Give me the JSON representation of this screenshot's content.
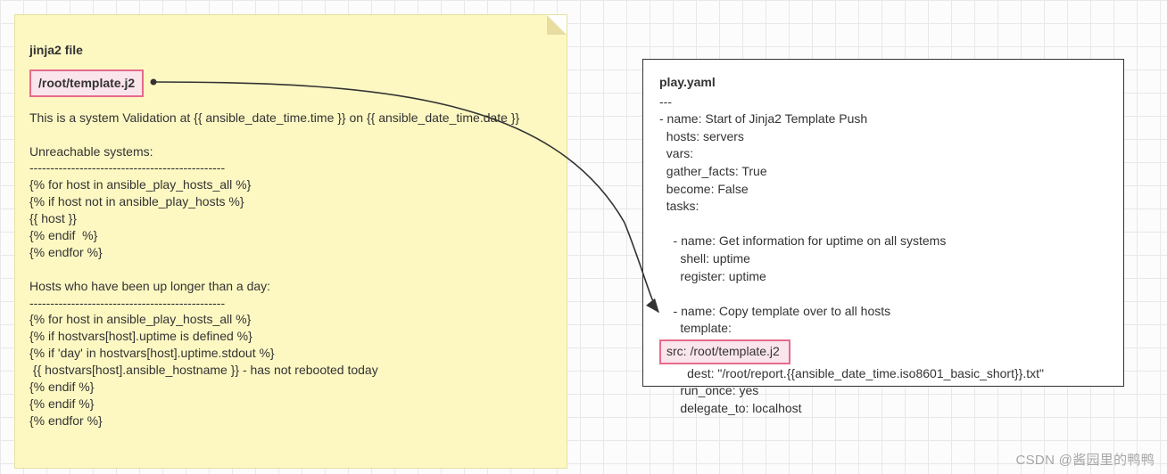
{
  "jinja": {
    "title": "jinja2 file",
    "file_path": "/root/template.j2",
    "body": "This is a system Validation at {{ ansible_date_time.time }} on {{ ansible_date_time.date }}\n\nUnreachable systems:\n-----------------------------------------------\n{% for host in ansible_play_hosts_all %}\n{% if host not in ansible_play_hosts %}\n{{ host }}\n{% endif  %}\n{% endfor %}\n\nHosts who have been up longer than a day:\n-----------------------------------------------\n{% for host in ansible_play_hosts_all %}\n{% if hostvars[host].uptime is defined %}\n{% if 'day' in hostvars[host].uptime.stdout %}\n {{ hostvars[host].ansible_hostname }} - has not rebooted today\n{% endif %}\n{% endif %}\n{% endfor %}"
  },
  "play": {
    "title": "play.yaml",
    "body_top": "---\n- name: Start of Jinja2 Template Push\n  hosts: servers\n  vars:\n  gather_facts: True\n  become: False\n  tasks:\n\n    - name: Get information for uptime on all systems\n      shell: uptime\n      register: uptime\n\n    - name: Copy template over to all hosts\n      template:",
    "src_line": "        src: /root/template.j2",
    "body_bottom": "        dest: \"/root/report.{{ansible_date_time.iso8601_basic_short}}.txt\"\n      run_once: yes\n      delegate_to: localhost"
  },
  "watermark": "CSDN @酱园里的鸭鸭"
}
